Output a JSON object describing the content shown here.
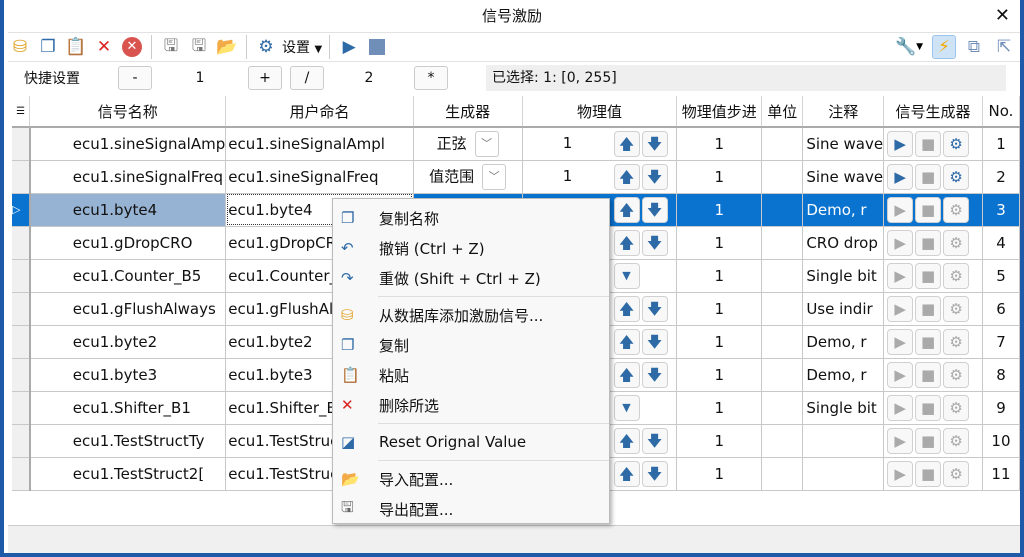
{
  "window": {
    "title": "信号激励",
    "close": "✕"
  },
  "toolbar": {
    "settings_label": "设置"
  },
  "quick": {
    "label": "快捷设置",
    "minus": "-",
    "value1": "1",
    "plus": "+",
    "divide": "/",
    "value2": "2",
    "multiply": "*",
    "selection": "已选择: 1: [0, 255]"
  },
  "table": {
    "headers": [
      "信号名称",
      "用户命名",
      "生成器",
      "物理值",
      "物理值步进",
      "单位",
      "注释",
      "信号生成器",
      "No."
    ],
    "rows": [
      {
        "name": "ecu1.sineSignalAmp",
        "user": "ecu1.sineSignalAmpl",
        "gen": "正弦",
        "phys": "1",
        "ctrl": "updown",
        "step": "1",
        "unit": "",
        "comment": "Sine wave",
        "active": true,
        "no": "1"
      },
      {
        "name": "ecu1.sineSignalFreq",
        "user": "ecu1.sineSignalFreq",
        "gen": "值范围",
        "phys": "1",
        "ctrl": "updown",
        "step": "1",
        "unit": "",
        "comment": "Sine wave",
        "active": true,
        "no": "2"
      },
      {
        "name": "ecu1.byte4",
        "user": "ecu1.byte4",
        "gen": "",
        "phys": "",
        "ctrl": "updown",
        "step": "1",
        "unit": "",
        "comment": "Demo, r",
        "active": false,
        "no": "3",
        "selected": true
      },
      {
        "name": "ecu1.gDropCRO",
        "user": "ecu1.gDropCRO",
        "gen": "",
        "phys": "",
        "ctrl": "updown",
        "step": "1",
        "unit": "",
        "comment": "CRO drop",
        "active": false,
        "no": "4"
      },
      {
        "name": "ecu1.Counter_B5",
        "user": "ecu1.Counter_B5",
        "gen": "",
        "phys": "",
        "ctrl": "dropdown",
        "step": "1",
        "unit": "",
        "comment": "Single bit",
        "active": false,
        "no": "5"
      },
      {
        "name": "ecu1.gFlushAlways",
        "user": "ecu1.gFlushAlways",
        "gen": "",
        "phys": "",
        "ctrl": "updown",
        "step": "1",
        "unit": "",
        "comment": "Use indir",
        "active": false,
        "no": "6"
      },
      {
        "name": "ecu1.byte2",
        "user": "ecu1.byte2",
        "gen": "",
        "phys": "",
        "ctrl": "updown",
        "step": "1",
        "unit": "",
        "comment": "Demo, r",
        "active": false,
        "no": "7"
      },
      {
        "name": "ecu1.byte3",
        "user": "ecu1.byte3",
        "gen": "",
        "phys": "",
        "ctrl": "updown",
        "step": "1",
        "unit": "",
        "comment": "Demo, r",
        "active": false,
        "no": "8"
      },
      {
        "name": "ecu1.Shifter_B1",
        "user": "ecu1.Shifter_B1",
        "gen": "",
        "phys": "",
        "ctrl": "dropdown",
        "step": "1",
        "unit": "",
        "comment": "Single bit",
        "active": false,
        "no": "9"
      },
      {
        "name": "ecu1.TestStructTy",
        "user": "ecu1.TestStruct",
        "gen": "",
        "phys": "",
        "ctrl": "updown",
        "step": "1",
        "unit": "",
        "comment": "",
        "active": false,
        "no": "10"
      },
      {
        "name": "ecu1.TestStruct2[",
        "user": "ecu1.TestStruct",
        "gen": "",
        "phys": "",
        "ctrl": "updown",
        "step": "1",
        "unit": "",
        "comment": "",
        "active": false,
        "no": "11"
      }
    ]
  },
  "context_menu": {
    "items": [
      {
        "label": "复制名称",
        "icon": "copy-icon"
      },
      {
        "label": "撤销 (Ctrl + Z)",
        "icon": "undo-icon"
      },
      {
        "label": "重做 (Shift + Ctrl + Z)",
        "icon": "redo-icon"
      },
      {
        "label": "从数据库添加激励信号...",
        "icon": "database-add-icon"
      },
      {
        "label": "复制",
        "icon": "copy-icon"
      },
      {
        "label": "粘贴",
        "icon": "paste-icon"
      },
      {
        "label": "删除所选",
        "icon": "delete-icon"
      },
      {
        "label": "Reset Orignal Value",
        "icon": "reset-icon"
      },
      {
        "label": "导入配置...",
        "icon": "import-icon"
      },
      {
        "label": "导出配置...",
        "icon": "export-icon"
      }
    ]
  },
  "colors": {
    "accent": "#0a73d0",
    "selected_name": "#97b3d3",
    "icon_blue": "#2e6aa6",
    "window_border": "#1e5aa8"
  }
}
